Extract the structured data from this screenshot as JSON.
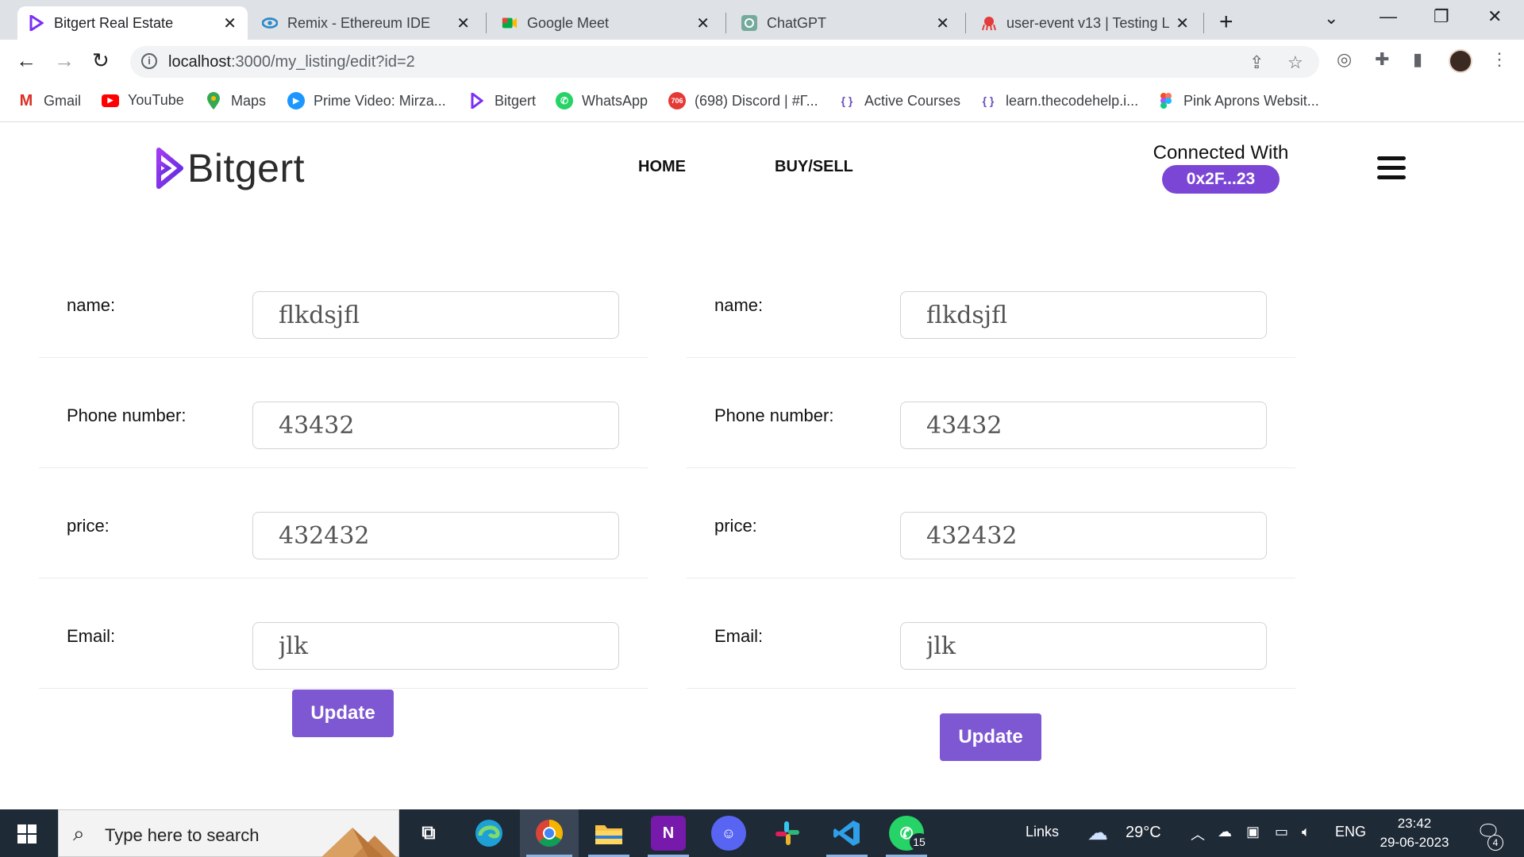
{
  "browser": {
    "tabs": [
      {
        "title": "Bitgert Real Estate",
        "active": true
      },
      {
        "title": "Remix - Ethereum IDE",
        "active": false
      },
      {
        "title": "Google Meet",
        "active": false
      },
      {
        "title": "ChatGPT",
        "active": false
      },
      {
        "title": "user-event v13 | Testing L",
        "active": false
      }
    ],
    "url_host": "localhost",
    "url_rest": ":3000/my_listing/edit?id=2",
    "bookmarks": [
      {
        "label": "Gmail",
        "icon": "gmail-icon",
        "color": "#d93025"
      },
      {
        "label": "YouTube",
        "icon": "youtube-icon",
        "color": "#ff0000"
      },
      {
        "label": "Maps",
        "icon": "maps-icon",
        "color": "#34a853"
      },
      {
        "label": "Prime Video: Mirza...",
        "icon": "prime-video-icon",
        "color": "#1a98ff"
      },
      {
        "label": "Bitgert",
        "icon": "bitgert-icon",
        "color": "#7b2ff7"
      },
      {
        "label": "WhatsApp",
        "icon": "whatsapp-icon",
        "color": "#25d366"
      },
      {
        "label": "(698) Discord | #Γ...",
        "icon": "discord-icon",
        "color": "#e53935",
        "badge": "706"
      },
      {
        "label": "Active Courses",
        "icon": "codehelp-icon",
        "color": "#6b4fbb"
      },
      {
        "label": "learn.thecodehelp.i...",
        "icon": "codehelp-icon",
        "color": "#6b4fbb"
      },
      {
        "label": "Pink Aprons Websit...",
        "icon": "figma-icon",
        "color": "#f24e1e"
      }
    ]
  },
  "header": {
    "brand": "Bitgert",
    "nav": [
      "HOME",
      "BUY/SELL"
    ],
    "connected_label": "Connected With",
    "wallet": "0x2F...23"
  },
  "forms": [
    {
      "fields": [
        {
          "label": "name:",
          "value": "flkdsjfl"
        },
        {
          "label": "Phone number:",
          "value": "43432"
        },
        {
          "label": "price:",
          "value": "432432"
        },
        {
          "label": "Email:",
          "value": "jlk"
        }
      ],
      "button": "Update"
    },
    {
      "fields": [
        {
          "label": "name:",
          "value": "flkdsjfl"
        },
        {
          "label": "Phone number:",
          "value": "43432"
        },
        {
          "label": "price:",
          "value": "432432"
        },
        {
          "label": "Email:",
          "value": "jlk"
        }
      ],
      "button": "Update"
    }
  ],
  "taskbar": {
    "search_placeholder": "Type here to search",
    "links": "Links",
    "weather": "29°C",
    "lang": "ENG",
    "time": "23:42",
    "date": "29-06-2023",
    "whatsapp_badge": "15",
    "notification_count": "4"
  },
  "colors": {
    "accent": "#7b46d6",
    "button": "#7e57d2",
    "taskbar": "#1f2a37"
  }
}
